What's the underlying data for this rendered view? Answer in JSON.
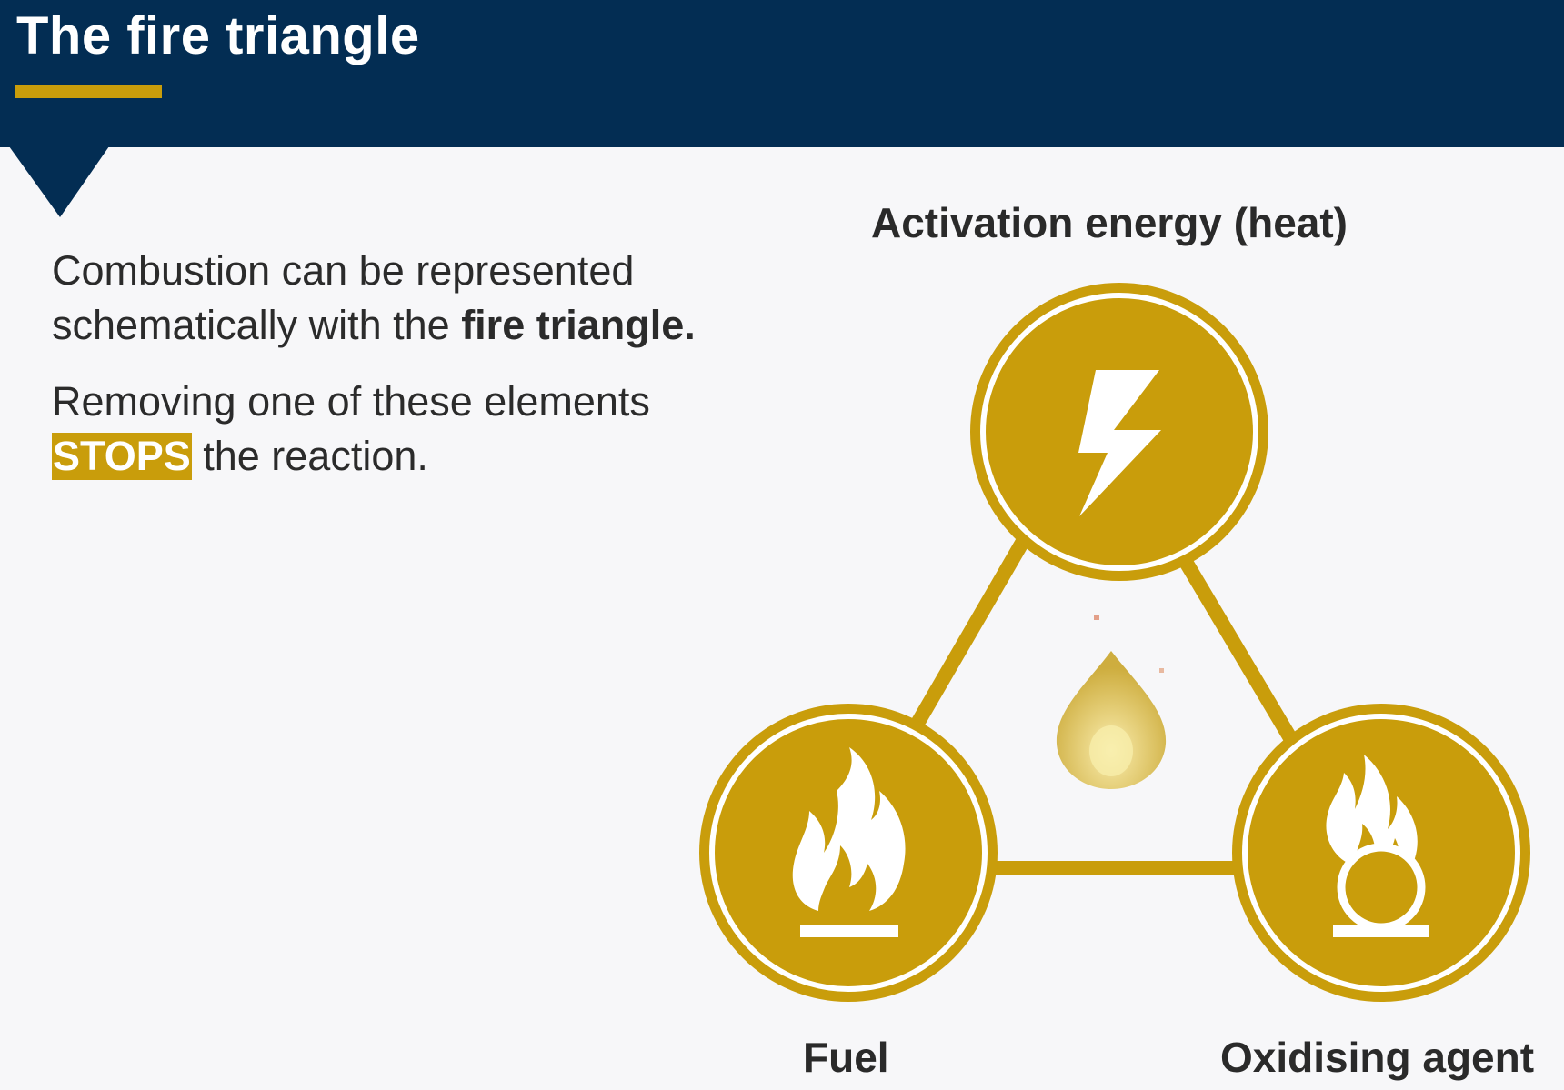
{
  "header": {
    "title": "The fire triangle"
  },
  "content": {
    "line1_a": "Combustion can be represented schematically with the ",
    "line1_bold": "fire triangle.",
    "line2_a": "Removing one of these elements ",
    "line2_highlight": "STOPS",
    "line2_b": " the reaction."
  },
  "diagram": {
    "top_label": "Activation energy (heat)",
    "left_label": "Fuel",
    "right_label": "Oxidising agent",
    "top_icon": "lightning-bolt-icon",
    "left_icon": "flame-icon",
    "right_icon": "flame-over-circle-icon",
    "center_icon": "flame-drop-icon"
  },
  "colors": {
    "navy": "#032d53",
    "gold": "#c99d0b",
    "background": "#f7f7f9",
    "text": "#2b2b2b"
  }
}
